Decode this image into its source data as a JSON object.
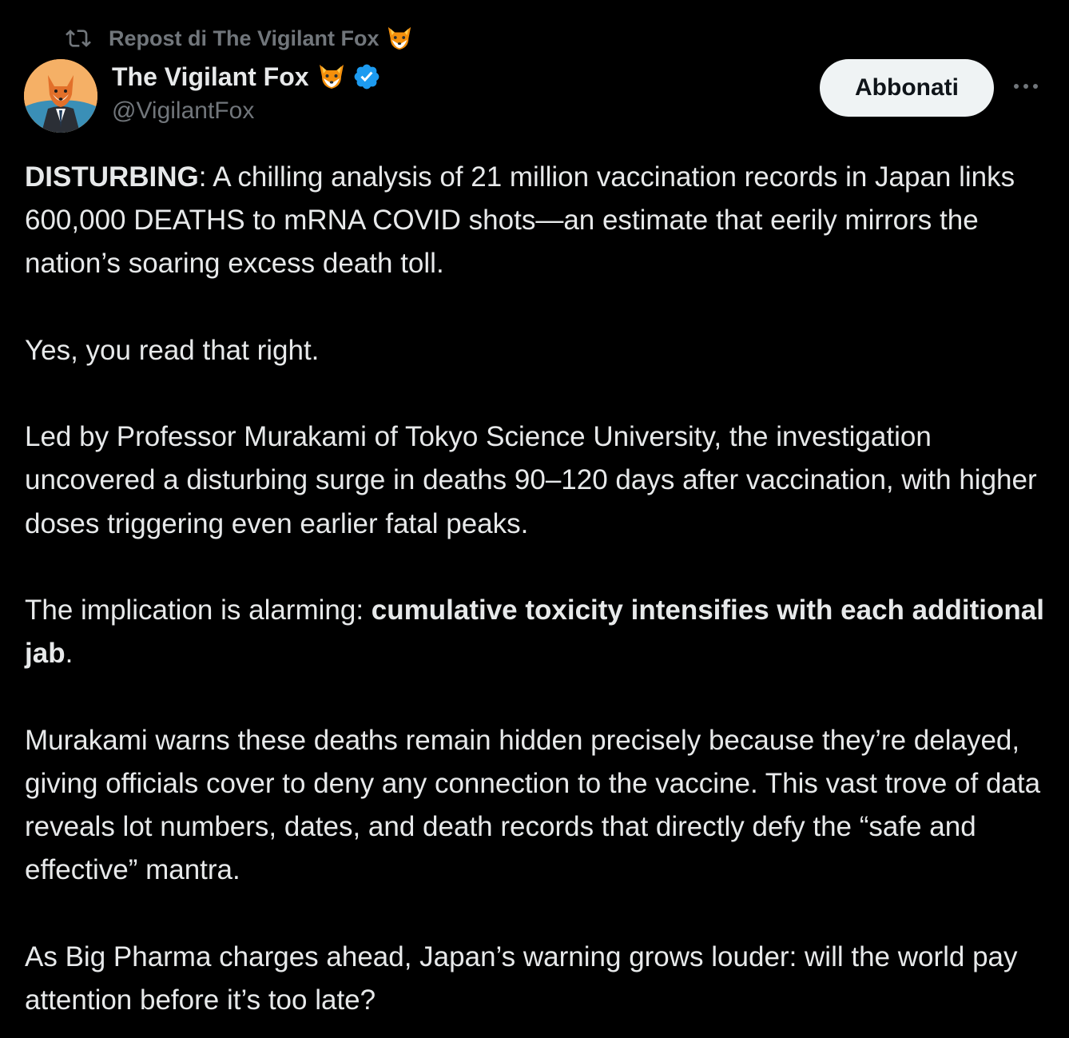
{
  "repost": {
    "text": "Repost di The Vigilant Fox"
  },
  "author": {
    "name": "The Vigilant Fox",
    "handle": "@VigilantFox",
    "verified": true,
    "name_emoji_icon": "fox-face-icon",
    "verified_color": "#1d9bf0"
  },
  "actions": {
    "subscribe_label": "Abbonati",
    "more_icon": "more-dots-icon"
  },
  "tweet": {
    "p1_bold": "DISTURBING",
    "p1_text": ": A chilling analysis of 21 million vaccination records in Japan links 600,000 DEATHS to mRNA COVID shots—an estimate that eerily mirrors the nation’s soaring excess death toll.",
    "p2_text": "Yes, you read that right.",
    "p3_text": "Led by Professor Murakami of Tokyo Science University, the investigation uncovered a disturbing surge in deaths 90–120 days after vaccination, with higher doses triggering even earlier fatal peaks.",
    "p4_text": "The implication is alarming: ",
    "p4_bold": "cumulative toxicity intensifies with each additional jab",
    "p4_end": ".",
    "p5_text": "Murakami warns these deaths remain hidden precisely because they’re delayed, giving officials cover to deny any connection to the vaccine. This vast trove of data reveals lot numbers, dates, and death records that directly defy the “safe and effective” mantra.",
    "p6_text": "As Big Pharma charges ahead, Japan’s warning grows louder: will the world pay attention before it’s too late?"
  },
  "colors": {
    "background": "#000000",
    "text_primary": "#e7e9ea",
    "text_secondary": "#71767b",
    "button_bg": "#eff3f4",
    "button_text": "#0f1419"
  }
}
